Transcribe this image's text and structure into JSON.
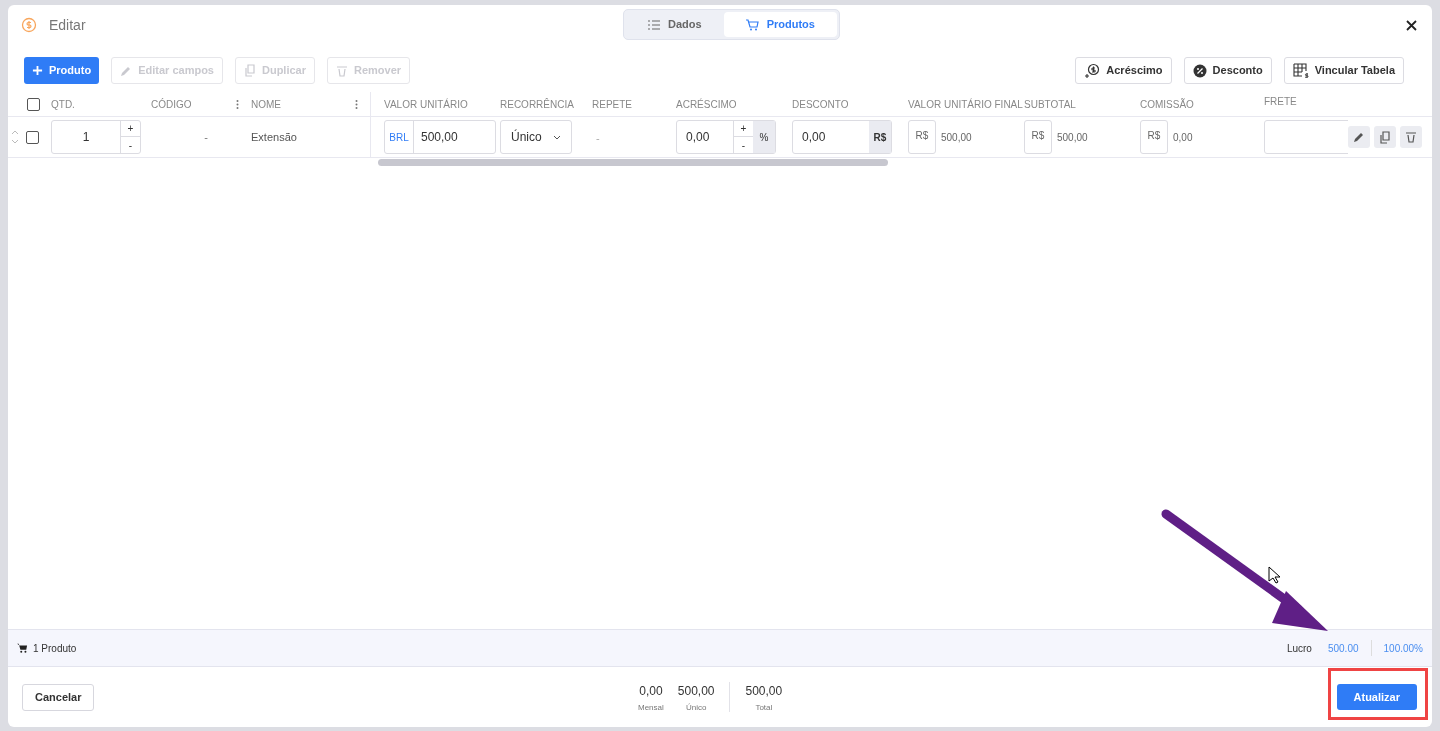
{
  "window": {
    "title": "Editar"
  },
  "tabs": [
    {
      "label": "Dados",
      "selected": false
    },
    {
      "label": "Produtos",
      "selected": true
    }
  ],
  "toolbar": {
    "left": [
      {
        "kind": "add",
        "label": "Produto",
        "disabled": false
      },
      {
        "kind": "edit",
        "label": "Editar campos",
        "disabled": true
      },
      {
        "kind": "copy",
        "label": "Duplicar",
        "disabled": true
      },
      {
        "kind": "trash",
        "label": "Remover",
        "disabled": true
      }
    ],
    "right": [
      {
        "kind": "plus-money",
        "label": "Acréscimo"
      },
      {
        "kind": "discount",
        "label": "Desconto"
      },
      {
        "kind": "table",
        "label": "Vincular Tabela"
      }
    ]
  },
  "table": {
    "all_checked": false,
    "columns": [
      "QTD.",
      "CÓDIGO",
      "NOME",
      "VALOR UNITÁRIO",
      "RECORRÊNCIA",
      "REPETE",
      "ACRÉSCIMO",
      "DESCONTO",
      "VALOR UNITÁRIO FINAL",
      "SUBTOTAL",
      "COMISSÃO",
      "FRETE"
    ],
    "rows": [
      {
        "checked": false,
        "qty": "1",
        "qty_up": "+",
        "qty_down": "-",
        "increase_up": "+",
        "increase_down": "-",
        "code": "-",
        "name": "Extensão",
        "currency": "BRL",
        "unit_price": "500,00",
        "recurrence": "Único",
        "repeat": "-",
        "increase": "0,00",
        "increase_unit": "%",
        "discount": "0,00",
        "discount_unit": "R$",
        "final_prefix": "R$",
        "final_price": "500,00",
        "subtotal_prefix": "R$",
        "subtotal": "500,00",
        "commission_prefix": "R$",
        "commission": "0,00"
      }
    ]
  },
  "summary": {
    "count": "1 Produto",
    "profit_label": "Lucro",
    "profit": "500.00",
    "profit_percent": "100.00%"
  },
  "footer": {
    "cancel": "Cancelar",
    "totals": [
      {
        "value": "0,00",
        "label": "Mensal"
      },
      {
        "value": "500,00",
        "label": "Único"
      }
    ],
    "total": {
      "value": "500,00",
      "label": "Total"
    },
    "submit": "Atualizar"
  }
}
